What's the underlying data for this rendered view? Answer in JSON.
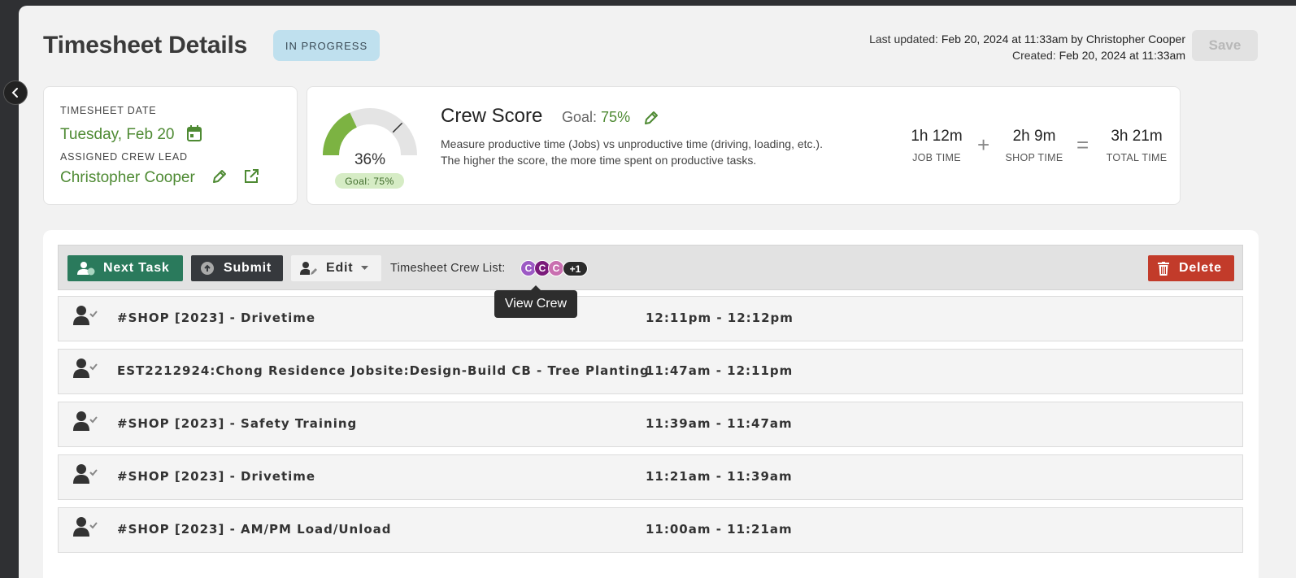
{
  "header": {
    "title": "Timesheet Details",
    "status": "IN PROGRESS",
    "last_updated_label": "Last updated:",
    "last_updated_value": "Feb 20, 2024 at 11:33am by Christopher Cooper",
    "created_label": "Created:",
    "created_value": "Feb 20, 2024 at 11:33am",
    "save_label": "Save"
  },
  "date_card": {
    "date_label": "TIMESHEET DATE",
    "date_value": "Tuesday, Feb 20",
    "lead_label": "ASSIGNED CREW LEAD",
    "lead_value": "Christopher Cooper"
  },
  "crew_score": {
    "percent": "36%",
    "percent_value": 36,
    "goal_value": 75,
    "gauge_goal": "Goal: 75%",
    "title": "Crew Score",
    "goal_label": "Goal:",
    "goal_text": "75%",
    "description": "Measure productive time (Jobs) vs unproductive time (driving, loading, etc.). The higher the score, the more time spent on productive tasks.",
    "job_time": "1h 12m",
    "job_time_label": "JOB TIME",
    "shop_time": "2h 9m",
    "shop_time_label": "SHOP TIME",
    "total_time": "3h 21m",
    "total_time_label": "TOTAL TIME",
    "plus": "+",
    "equals": "=",
    "colors": {
      "fill": "#7cb342",
      "track": "#e4e4e4"
    }
  },
  "toolbar": {
    "next_task": "Next Task",
    "submit": "Submit",
    "edit": "Edit",
    "crew_list_label": "Timesheet Crew List:",
    "crew_avatars": [
      {
        "initial": "C",
        "color": "#9c59c4"
      },
      {
        "initial": "C",
        "color": "#7a1a7a"
      },
      {
        "initial": "C",
        "color": "#c96fb0"
      }
    ],
    "crew_more": "+1",
    "delete": "Delete"
  },
  "tooltip": "View Crew",
  "tasks": [
    {
      "name": "#SHOP [2023] - Drivetime",
      "time": "12:11pm - 12:12pm"
    },
    {
      "name": "EST2212924:Chong Residence Jobsite:Design-Build CB - Tree Planting",
      "time": "11:47am - 12:11pm"
    },
    {
      "name": "#SHOP [2023] - Safety Training",
      "time": "11:39am - 11:47am"
    },
    {
      "name": "#SHOP [2023] - Drivetime",
      "time": "11:21am - 11:39am"
    },
    {
      "name": "#SHOP [2023] - AM/PM Load/Unload",
      "time": "11:00am - 11:21am"
    }
  ]
}
